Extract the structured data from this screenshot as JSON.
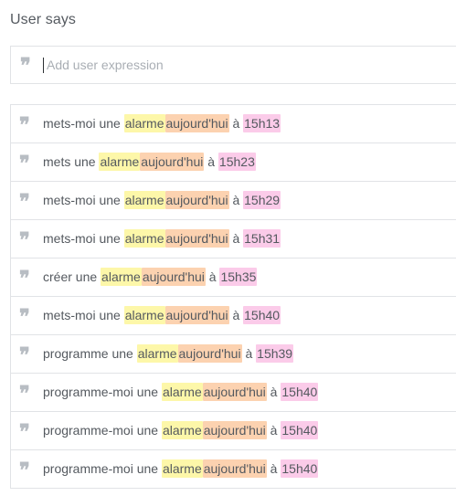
{
  "section": {
    "title": "User says"
  },
  "input": {
    "placeholder": "Add user expression",
    "value": ""
  },
  "quote_glyph": "❞",
  "colors": {
    "alarme": "#fdf7a9",
    "date": "#fcd2b0",
    "time": "#fbcbe9",
    "text": "#54595f",
    "border": "#e1e3e6"
  },
  "expressions": [
    {
      "prefix": "mets-moi une ",
      "alarme": "alarme",
      "date": "aujourd'hui",
      "sep": " à ",
      "time": "15h13"
    },
    {
      "prefix": "mets une ",
      "alarme": "alarme",
      "date": "aujourd'hui",
      "sep": " à ",
      "time": "15h23"
    },
    {
      "prefix": "mets-moi une ",
      "alarme": "alarme",
      "date": "aujourd'hui",
      "sep": " à ",
      "time": "15h29"
    },
    {
      "prefix": "mets-moi une ",
      "alarme": "alarme",
      "date": "aujourd'hui",
      "sep": " à ",
      "time": "15h31"
    },
    {
      "prefix": "créer une ",
      "alarme": "alarme",
      "date": "aujourd'hui",
      "sep": " à ",
      "time": "15h35"
    },
    {
      "prefix": "mets-moi une ",
      "alarme": "alarme",
      "date": "aujourd'hui",
      "sep": " à ",
      "time": "15h40"
    },
    {
      "prefix": "programme une ",
      "alarme": "alarme",
      "date": "aujourd'hui",
      "sep": " à ",
      "time": "15h39"
    },
    {
      "prefix": "programme-moi une ",
      "alarme": "alarme",
      "date": "aujourd'hui",
      "sep": " à ",
      "time": "15h40"
    },
    {
      "prefix": "programme-moi une ",
      "alarme": "alarme",
      "date": "aujourd'hui",
      "sep": " à ",
      "time": "15h40"
    },
    {
      "prefix": "programme-moi une ",
      "alarme": "alarme",
      "date": "aujourd'hui",
      "sep": " à ",
      "time": "15h40"
    }
  ]
}
